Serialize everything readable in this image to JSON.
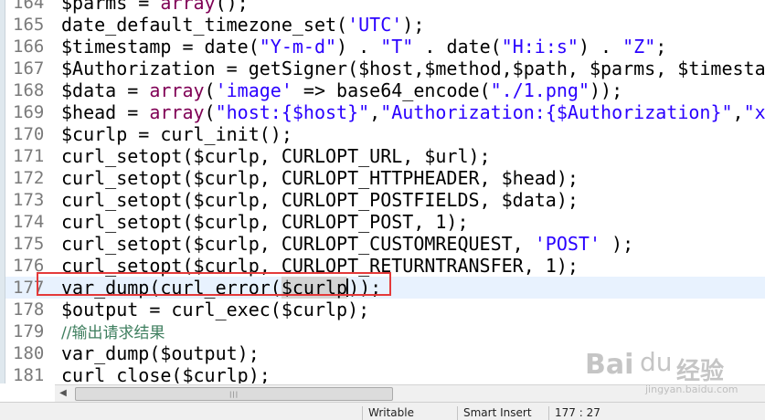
{
  "editor": {
    "lines": [
      {
        "num": "164",
        "segments": [
          {
            "t": "$parms = ",
            "c": ""
          },
          {
            "t": "array",
            "c": "kw"
          },
          {
            "t": "();",
            "c": ""
          }
        ]
      },
      {
        "num": "165",
        "segments": [
          {
            "t": "date_default_timezone_set(",
            "c": ""
          },
          {
            "t": "'UTC'",
            "c": "str"
          },
          {
            "t": ");",
            "c": ""
          }
        ]
      },
      {
        "num": "166",
        "segments": [
          {
            "t": "$timestamp = date(",
            "c": ""
          },
          {
            "t": "\"Y-m-d\"",
            "c": "str"
          },
          {
            "t": ") . ",
            "c": ""
          },
          {
            "t": "\"T\"",
            "c": "str"
          },
          {
            "t": " . date(",
            "c": ""
          },
          {
            "t": "\"H:i:s\"",
            "c": "str"
          },
          {
            "t": ") . ",
            "c": ""
          },
          {
            "t": "\"Z\"",
            "c": "str"
          },
          {
            "t": ";",
            "c": ""
          }
        ]
      },
      {
        "num": "167",
        "segments": [
          {
            "t": "$Authorization = getSigner($host,$method,$path, $parms, $timestam",
            "c": ""
          }
        ]
      },
      {
        "num": "168",
        "segments": [
          {
            "t": "$data = ",
            "c": ""
          },
          {
            "t": "array",
            "c": "kw"
          },
          {
            "t": "(",
            "c": ""
          },
          {
            "t": "'image'",
            "c": "str"
          },
          {
            "t": " => base64_encode(",
            "c": ""
          },
          {
            "t": "\"./1.png\"",
            "c": "str"
          },
          {
            "t": "));",
            "c": ""
          }
        ]
      },
      {
        "num": "169",
        "segments": [
          {
            "t": "$head = ",
            "c": ""
          },
          {
            "t": "array",
            "c": "kw"
          },
          {
            "t": "(",
            "c": ""
          },
          {
            "t": "\"host:{$host}\"",
            "c": "str"
          },
          {
            "t": ",",
            "c": ""
          },
          {
            "t": "\"Authorization:{$Authorization}\"",
            "c": "str"
          },
          {
            "t": ",",
            "c": ""
          },
          {
            "t": "\"x",
            "c": "str"
          }
        ]
      },
      {
        "num": "170",
        "segments": [
          {
            "t": "$curlp = curl_init();",
            "c": ""
          }
        ]
      },
      {
        "num": "171",
        "segments": [
          {
            "t": "curl_setopt($curlp, CURLOPT_URL, $url);",
            "c": ""
          }
        ]
      },
      {
        "num": "172",
        "segments": [
          {
            "t": "curl_setopt($curlp, CURLOPT_HTTPHEADER, $head);",
            "c": ""
          }
        ]
      },
      {
        "num": "173",
        "segments": [
          {
            "t": "curl_setopt($curlp, CURLOPT_POSTFIELDS, $data);",
            "c": ""
          }
        ]
      },
      {
        "num": "174",
        "segments": [
          {
            "t": "curl_setopt($curlp, CURLOPT_POST, 1);",
            "c": ""
          }
        ]
      },
      {
        "num": "175",
        "segments": [
          {
            "t": "curl_setopt($curlp, CURLOPT_CUSTOMREQUEST, ",
            "c": ""
          },
          {
            "t": "'POST'",
            "c": "str"
          },
          {
            "t": " );",
            "c": ""
          }
        ]
      },
      {
        "num": "176",
        "segments": [
          {
            "t": "curl_setopt($curlp, CURLOPT_RETURNTRANSFER, 1);",
            "c": ""
          }
        ]
      },
      {
        "num": "177",
        "current": true,
        "segments": [
          {
            "t": "var_dump(curl_error(",
            "c": ""
          },
          {
            "t": "$curlp",
            "c": "sel"
          },
          {
            "t": "CARET",
            "c": "caret"
          },
          {
            "t": "));",
            "c": ""
          }
        ]
      },
      {
        "num": "178",
        "segments": [
          {
            "t": "$output = curl_exec($curlp);",
            "c": ""
          }
        ]
      },
      {
        "num": "179",
        "segments": [
          {
            "t": "//输出请求结果",
            "c": "cmt"
          }
        ]
      },
      {
        "num": "180",
        "segments": [
          {
            "t": "var_dump($output);",
            "c": ""
          }
        ]
      },
      {
        "num": "181",
        "segments": [
          {
            "t": "curl_close($curlp);",
            "c": ""
          }
        ]
      }
    ],
    "highlight_line": "177"
  },
  "scrollbar": {
    "left_arrow": "◀",
    "thumb_grip": "|||"
  },
  "statusbar": {
    "mode": "Writable",
    "insert": "Smart Insert",
    "position": "177 : 27"
  },
  "watermark": {
    "brand": "Bai",
    "paw": "du",
    "cn": "经验",
    "url": "jingyan.baidu.com"
  },
  "colors": {
    "keyword": "#7f0055",
    "string": "#2a00ff",
    "comment": "#3f7f5f",
    "highlight_box": "#e43a3a",
    "current_line": "#e8f2fe"
  }
}
